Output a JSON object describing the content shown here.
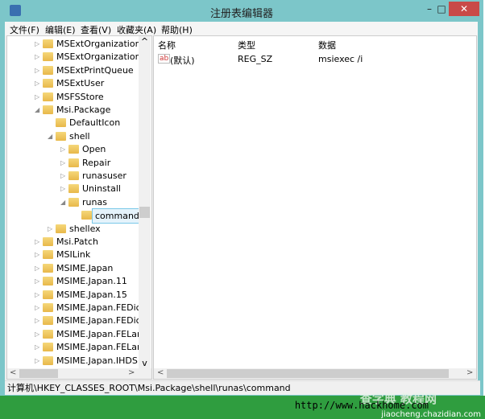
{
  "window": {
    "title": "注册表编辑器",
    "minimize": "–",
    "maximize": "□",
    "close": "✕"
  },
  "menu": [
    "文件(F)",
    "编辑(E)",
    "查看(V)",
    "收藏夹(A)",
    "帮助(H)"
  ],
  "tree": [
    {
      "label": "MSExtOrganization",
      "level": 0,
      "expander": "collapsed"
    },
    {
      "label": "MSExtOrganizationU",
      "level": 0,
      "expander": "collapsed"
    },
    {
      "label": "MSExtPrintQueue",
      "level": 0,
      "expander": "collapsed"
    },
    {
      "label": "MSExtUser",
      "level": 0,
      "expander": "collapsed"
    },
    {
      "label": "MSFSStore",
      "level": 0,
      "expander": "collapsed"
    },
    {
      "label": "Msi.Package",
      "level": 0,
      "expander": "expanded"
    },
    {
      "label": "DefaultIcon",
      "level": 1,
      "expander": "none"
    },
    {
      "label": "shell",
      "level": 1,
      "expander": "expanded"
    },
    {
      "label": "Open",
      "level": 2,
      "expander": "collapsed"
    },
    {
      "label": "Repair",
      "level": 2,
      "expander": "collapsed"
    },
    {
      "label": "runasuser",
      "level": 2,
      "expander": "collapsed"
    },
    {
      "label": "Uninstall",
      "level": 2,
      "expander": "collapsed"
    },
    {
      "label": "runas",
      "level": 2,
      "expander": "expanded"
    },
    {
      "label": "command",
      "level": 3,
      "expander": "none",
      "selected": true
    },
    {
      "label": "shellex",
      "level": 1,
      "expander": "collapsed"
    },
    {
      "label": "Msi.Patch",
      "level": 0,
      "expander": "collapsed"
    },
    {
      "label": "MSILink",
      "level": 0,
      "expander": "collapsed"
    },
    {
      "label": "MSIME.Japan",
      "level": 0,
      "expander": "collapsed"
    },
    {
      "label": "MSIME.Japan.11",
      "level": 0,
      "expander": "collapsed"
    },
    {
      "label": "MSIME.Japan.15",
      "level": 0,
      "expander": "collapsed"
    },
    {
      "label": "MSIME.Japan.FEDict",
      "level": 0,
      "expander": "collapsed"
    },
    {
      "label": "MSIME.Japan.FEDict.",
      "level": 0,
      "expander": "collapsed"
    },
    {
      "label": "MSIME.Japan.FELang",
      "level": 0,
      "expander": "collapsed"
    },
    {
      "label": "MSIME.Japan.FELang",
      "level": 0,
      "expander": "collapsed"
    },
    {
      "label": "MSIME.Japan.IHDS",
      "level": 0,
      "expander": "collapsed"
    }
  ],
  "columns": {
    "name": "名称",
    "type": "类型",
    "data": "数据"
  },
  "values": [
    {
      "icon": "ab",
      "name": "(默认)",
      "type": "REG_SZ",
      "data": "msiexec /i"
    }
  ],
  "status": "计算机\\HKEY_CLASSES_ROOT\\Msi.Package\\shell\\runas\\command",
  "watermark": {
    "url": "http://www.hackhome.com",
    "brand": "查字典 教程网",
    "site": "jiaocheng.chazidian.com"
  },
  "scroll": {
    "up": "^",
    "down": "v",
    "left": "<",
    "right": ">"
  }
}
